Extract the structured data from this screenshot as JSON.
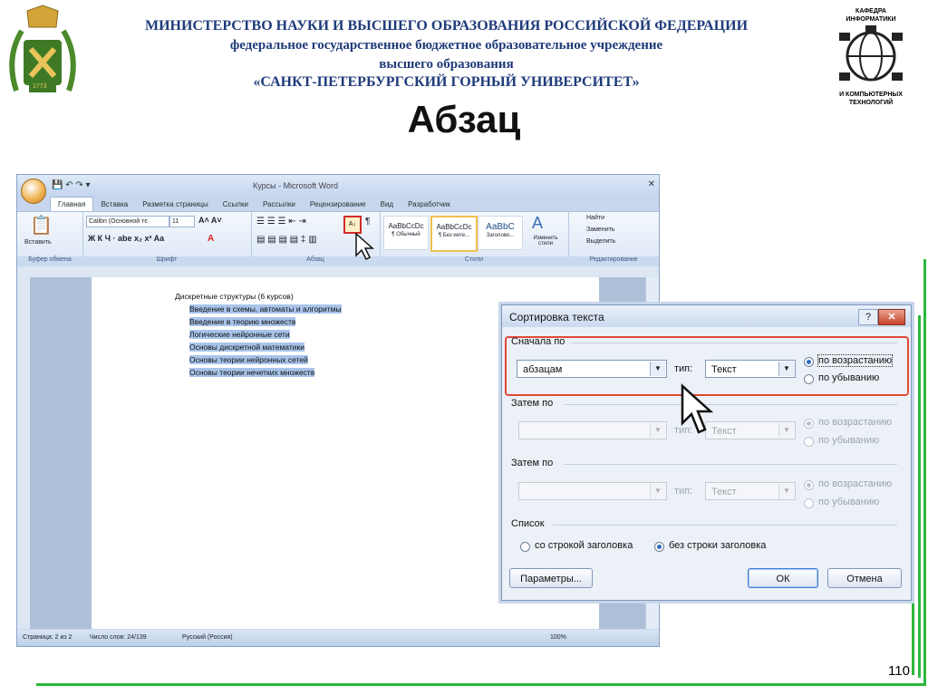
{
  "header": {
    "ministry": "МИНИСТЕРСТВО НАУКИ И ВЫСШЕГО ОБРАЗОВАНИЯ РОССИЙСКОЙ ФЕДЕРАЦИИ",
    "institution_line1": "федеральное государственное бюджетное образовательное учреждение",
    "institution_line2": "высшего образования",
    "university": "«САНКТ-ПЕТЕРБУРГСКИЙ ГОРНЫЙ УНИВЕРСИТЕТ»",
    "slide_title": "Абзац",
    "dept_logo_top": "КАФЕДРА ИНФОРМАТИКИ",
    "dept_logo_bottom": "И КОМПЬЮТЕРНЫХ ТЕХНОЛОГИЙ",
    "emblem_year": "1773"
  },
  "page_number": "110",
  "colors": {
    "accent_green": "#2db83d",
    "header_blue": "#1f3b7a",
    "highlight_red": "#e04a35"
  },
  "word": {
    "window_title": "Курсы - Microsoft Word",
    "tabs": [
      "Главная",
      "Вставка",
      "Разметка страницы",
      "Ссылки",
      "Рассылки",
      "Рецензирование",
      "Вид",
      "Разработчик"
    ],
    "active_tab": "Главная",
    "ribbon": {
      "paste_label": "Вставить",
      "clipboard_group": "Буфер обмена",
      "font_name": "Calibri (Основной тє",
      "font_size": "11",
      "font_group": "Шрифт",
      "paragraph_group": "Абзац",
      "sort_button_glyph": "А↓",
      "styles": [
        {
          "preview": "AaBbCcDc",
          "name": "¶ Обычный"
        },
        {
          "preview": "AaBbCcDc",
          "name": "¶ Без инте..."
        },
        {
          "preview": "AaBbC",
          "name": "Заголово..."
        }
      ],
      "change_styles": "Изменить стили",
      "styles_group": "Стили",
      "find": "Найти",
      "replace": "Заменить",
      "select": "Выделить",
      "editing_group": "Редактирование"
    },
    "document": {
      "heading": "Дискретные структуры (6 курсов)",
      "items": [
        "Введение в схемы, автоматы и алгоритмы",
        "Введение в теорию множеств",
        "Логические нейронные сети",
        "Основы дискретной математики",
        "Основы теории нейронных сетей",
        "Основы теории нечетких множеств"
      ]
    },
    "status": {
      "page": "Страница: 2 из 2",
      "words": "Число слов: 24/139",
      "language": "Русский (Россия)",
      "zoom": "100%"
    }
  },
  "dialog": {
    "title": "Сортировка текста",
    "help": "?",
    "close": "✕",
    "first_by": "Сначала по",
    "first_field": "абзацам",
    "type_label": "тип:",
    "first_type": "Текст",
    "ascending": "по возрастанию",
    "descending": "по убыванию",
    "then_by_1": "Затем по",
    "then_by_2": "Затем по",
    "then_type": "Текст",
    "list_label": "Список",
    "with_header": "со строкой заголовка",
    "without_header": "без строки заголовка",
    "options_button": "Параметры...",
    "ok_button": "ОК",
    "cancel_button": "Отмена"
  }
}
